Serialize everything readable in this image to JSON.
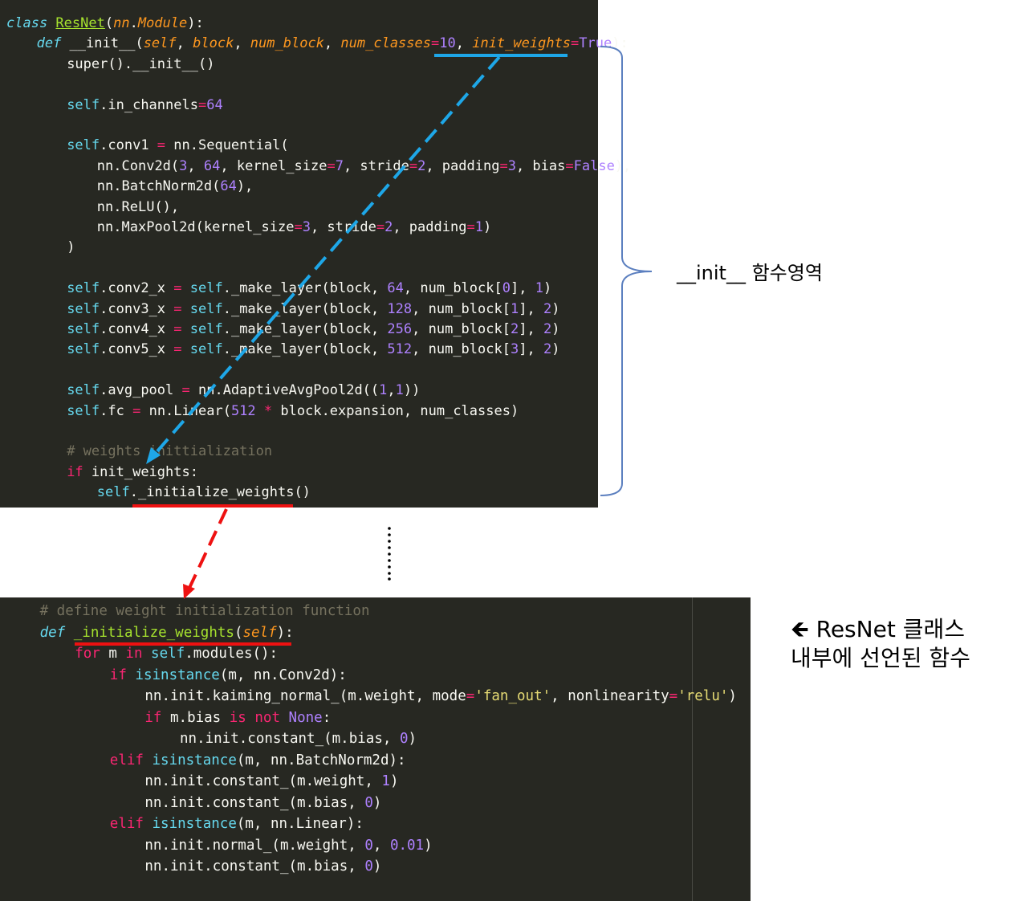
{
  "top_code": [
    {
      "indent": 0,
      "tokens": [
        [
          "class ",
          "kw-italic"
        ],
        [
          "ResNet",
          "class"
        ],
        [
          "(",
          "plain"
        ],
        [
          "nn",
          "param"
        ],
        [
          ".",
          "plain"
        ],
        [
          "Module",
          "param"
        ],
        [
          "):",
          "plain"
        ]
      ]
    },
    {
      "indent": 4,
      "tokens": [
        [
          "def ",
          "kw-italic"
        ],
        [
          "__init__",
          "plain"
        ],
        [
          "(",
          "plain"
        ],
        [
          "self",
          "param"
        ],
        [
          ", ",
          "plain"
        ],
        [
          "block",
          "param"
        ],
        [
          ", ",
          "plain"
        ],
        [
          "num_block",
          "param"
        ],
        [
          ", ",
          "plain"
        ],
        [
          "num_classes",
          "param"
        ],
        [
          "=",
          "op"
        ],
        [
          "10",
          "num"
        ],
        [
          ", ",
          "plain"
        ],
        [
          "init_weights",
          "param"
        ],
        [
          "=",
          "op"
        ],
        [
          "True",
          "const"
        ],
        [
          "):",
          "plain"
        ]
      ]
    },
    {
      "indent": 8,
      "tokens": [
        [
          "super",
          "plain"
        ],
        [
          "().",
          "plain"
        ],
        [
          "__init__",
          "plain"
        ],
        [
          "()",
          "plain"
        ]
      ]
    },
    {
      "indent": 0,
      "tokens": []
    },
    {
      "indent": 8,
      "tokens": [
        [
          "self",
          "self"
        ],
        [
          ".in_channels",
          "plain"
        ],
        [
          "=",
          "op"
        ],
        [
          "64",
          "num"
        ]
      ]
    },
    {
      "indent": 0,
      "tokens": []
    },
    {
      "indent": 8,
      "tokens": [
        [
          "self",
          "self"
        ],
        [
          ".conv1 ",
          "plain"
        ],
        [
          "=",
          "op"
        ],
        [
          " nn.Sequential(",
          "plain"
        ]
      ]
    },
    {
      "indent": 12,
      "tokens": [
        [
          "nn.Conv2d(",
          "plain"
        ],
        [
          "3",
          "num"
        ],
        [
          ", ",
          "plain"
        ],
        [
          "64",
          "num"
        ],
        [
          ", kernel_size",
          "plain"
        ],
        [
          "=",
          "op"
        ],
        [
          "7",
          "num"
        ],
        [
          ", stride",
          "plain"
        ],
        [
          "=",
          "op"
        ],
        [
          "2",
          "num"
        ],
        [
          ", padding",
          "plain"
        ],
        [
          "=",
          "op"
        ],
        [
          "3",
          "num"
        ],
        [
          ", bias",
          "plain"
        ],
        [
          "=",
          "op"
        ],
        [
          "False",
          "const"
        ],
        [
          "),",
          "plain"
        ]
      ]
    },
    {
      "indent": 12,
      "tokens": [
        [
          "nn.BatchNorm2d(",
          "plain"
        ],
        [
          "64",
          "num"
        ],
        [
          "),",
          "plain"
        ]
      ]
    },
    {
      "indent": 12,
      "tokens": [
        [
          "nn.ReLU(),",
          "plain"
        ]
      ]
    },
    {
      "indent": 12,
      "tokens": [
        [
          "nn.MaxPool2d(kernel_size",
          "plain"
        ],
        [
          "=",
          "op"
        ],
        [
          "3",
          "num"
        ],
        [
          ", stride",
          "plain"
        ],
        [
          "=",
          "op"
        ],
        [
          "2",
          "num"
        ],
        [
          ", padding",
          "plain"
        ],
        [
          "=",
          "op"
        ],
        [
          "1",
          "num"
        ],
        [
          ")",
          "plain"
        ]
      ]
    },
    {
      "indent": 8,
      "tokens": [
        [
          ")",
          "plain"
        ]
      ]
    },
    {
      "indent": 0,
      "tokens": []
    },
    {
      "indent": 8,
      "tokens": [
        [
          "self",
          "self"
        ],
        [
          ".conv2_x ",
          "plain"
        ],
        [
          "=",
          "op"
        ],
        [
          " ",
          "plain"
        ],
        [
          "self",
          "self"
        ],
        [
          "._make_layer(block, ",
          "plain"
        ],
        [
          "64",
          "num"
        ],
        [
          ", num_block[",
          "plain"
        ],
        [
          "0",
          "num"
        ],
        [
          "], ",
          "plain"
        ],
        [
          "1",
          "num"
        ],
        [
          ")",
          "plain"
        ]
      ]
    },
    {
      "indent": 8,
      "tokens": [
        [
          "self",
          "self"
        ],
        [
          ".conv3_x ",
          "plain"
        ],
        [
          "=",
          "op"
        ],
        [
          " ",
          "plain"
        ],
        [
          "self",
          "self"
        ],
        [
          "._make_layer(block, ",
          "plain"
        ],
        [
          "128",
          "num"
        ],
        [
          ", num_block[",
          "plain"
        ],
        [
          "1",
          "num"
        ],
        [
          "], ",
          "plain"
        ],
        [
          "2",
          "num"
        ],
        [
          ")",
          "plain"
        ]
      ]
    },
    {
      "indent": 8,
      "tokens": [
        [
          "self",
          "self"
        ],
        [
          ".conv4_x ",
          "plain"
        ],
        [
          "=",
          "op"
        ],
        [
          " ",
          "plain"
        ],
        [
          "self",
          "self"
        ],
        [
          "._make_layer(block, ",
          "plain"
        ],
        [
          "256",
          "num"
        ],
        [
          ", num_block[",
          "plain"
        ],
        [
          "2",
          "num"
        ],
        [
          "], ",
          "plain"
        ],
        [
          "2",
          "num"
        ],
        [
          ")",
          "plain"
        ]
      ]
    },
    {
      "indent": 8,
      "tokens": [
        [
          "self",
          "self"
        ],
        [
          ".conv5_x ",
          "plain"
        ],
        [
          "=",
          "op"
        ],
        [
          " ",
          "plain"
        ],
        [
          "self",
          "self"
        ],
        [
          "._make_layer(block, ",
          "plain"
        ],
        [
          "512",
          "num"
        ],
        [
          ", num_block[",
          "plain"
        ],
        [
          "3",
          "num"
        ],
        [
          "], ",
          "plain"
        ],
        [
          "2",
          "num"
        ],
        [
          ")",
          "plain"
        ]
      ]
    },
    {
      "indent": 0,
      "tokens": []
    },
    {
      "indent": 8,
      "tokens": [
        [
          "self",
          "self"
        ],
        [
          ".avg_pool ",
          "plain"
        ],
        [
          "=",
          "op"
        ],
        [
          " nn.AdaptiveAvgPool2d((",
          "plain"
        ],
        [
          "1",
          "num"
        ],
        [
          ",",
          "plain"
        ],
        [
          "1",
          "num"
        ],
        [
          "))",
          "plain"
        ]
      ]
    },
    {
      "indent": 8,
      "tokens": [
        [
          "self",
          "self"
        ],
        [
          ".fc ",
          "plain"
        ],
        [
          "=",
          "op"
        ],
        [
          " nn.Linear(",
          "plain"
        ],
        [
          "512",
          "num"
        ],
        [
          " ",
          "plain"
        ],
        [
          "*",
          "op"
        ],
        [
          " block.expansion, num_classes)",
          "plain"
        ]
      ]
    },
    {
      "indent": 0,
      "tokens": []
    },
    {
      "indent": 8,
      "tokens": [
        [
          "# weights inittialization",
          "cmt"
        ]
      ]
    },
    {
      "indent": 8,
      "tokens": [
        [
          "if",
          "kw"
        ],
        [
          " init_weights:",
          "plain"
        ]
      ]
    },
    {
      "indent": 12,
      "tokens": [
        [
          "self",
          "self"
        ],
        [
          "._initialize_weights()",
          "plain"
        ]
      ]
    }
  ],
  "bottom_code": [
    {
      "indent": 4,
      "tokens": [
        [
          "# define weight initialization function",
          "cmt"
        ]
      ]
    },
    {
      "indent": 4,
      "tokens": [
        [
          "def ",
          "kw-italic"
        ],
        [
          "_initialize_weights",
          "fn"
        ],
        [
          "(",
          "plain"
        ],
        [
          "self",
          "param"
        ],
        [
          "):",
          "plain"
        ]
      ]
    },
    {
      "indent": 8,
      "tokens": [
        [
          "for",
          "kw"
        ],
        [
          " m ",
          "plain"
        ],
        [
          "in",
          "kw"
        ],
        [
          " ",
          "plain"
        ],
        [
          "self",
          "self"
        ],
        [
          ".modules():",
          "plain"
        ]
      ]
    },
    {
      "indent": 12,
      "tokens": [
        [
          "if",
          "kw"
        ],
        [
          " ",
          "plain"
        ],
        [
          "isinstance",
          "builtin"
        ],
        [
          "(m, nn.Conv2d):",
          "plain"
        ]
      ]
    },
    {
      "indent": 16,
      "tokens": [
        [
          "nn.init.kaiming_normal_(m.weight, mode",
          "plain"
        ],
        [
          "=",
          "op"
        ],
        [
          "'fan_out'",
          "str"
        ],
        [
          ", nonlinearity",
          "plain"
        ],
        [
          "=",
          "op"
        ],
        [
          "'relu'",
          "str"
        ],
        [
          ")",
          "plain"
        ]
      ]
    },
    {
      "indent": 16,
      "tokens": [
        [
          "if",
          "kw"
        ],
        [
          " m.bias ",
          "plain"
        ],
        [
          "is",
          "kw"
        ],
        [
          " ",
          "plain"
        ],
        [
          "not",
          "kw"
        ],
        [
          " ",
          "plain"
        ],
        [
          "None",
          "const"
        ],
        [
          ":",
          "plain"
        ]
      ]
    },
    {
      "indent": 20,
      "tokens": [
        [
          "nn.init.constant_(m.bias, ",
          "plain"
        ],
        [
          "0",
          "num"
        ],
        [
          ")",
          "plain"
        ]
      ]
    },
    {
      "indent": 12,
      "tokens": [
        [
          "elif",
          "kw"
        ],
        [
          " ",
          "plain"
        ],
        [
          "isinstance",
          "builtin"
        ],
        [
          "(m, nn.BatchNorm2d):",
          "plain"
        ]
      ]
    },
    {
      "indent": 16,
      "tokens": [
        [
          "nn.init.constant_(m.weight, ",
          "plain"
        ],
        [
          "1",
          "num"
        ],
        [
          ")",
          "plain"
        ]
      ]
    },
    {
      "indent": 16,
      "tokens": [
        [
          "nn.init.constant_(m.bias, ",
          "plain"
        ],
        [
          "0",
          "num"
        ],
        [
          ")",
          "plain"
        ]
      ]
    },
    {
      "indent": 12,
      "tokens": [
        [
          "elif",
          "kw"
        ],
        [
          " ",
          "plain"
        ],
        [
          "isinstance",
          "builtin"
        ],
        [
          "(m, nn.Linear):",
          "plain"
        ]
      ]
    },
    {
      "indent": 16,
      "tokens": [
        [
          "nn.init.normal_(m.weight, ",
          "plain"
        ],
        [
          "0",
          "num"
        ],
        [
          ", ",
          "plain"
        ],
        [
          "0.01",
          "num"
        ],
        [
          ")",
          "plain"
        ]
      ]
    },
    {
      "indent": 16,
      "tokens": [
        [
          "nn.init.constant_(m.bias, ",
          "plain"
        ],
        [
          "0",
          "num"
        ],
        [
          ")",
          "plain"
        ]
      ]
    }
  ],
  "annotations": {
    "init_region_label": "__init__ 함수영역",
    "inner_function_label": "🡸 ResNet 클래스\n내부에 선언된 함수"
  },
  "colors": {
    "editor_bg": "#272822",
    "blue_arrow": "#1ea7e8",
    "red_arrow": "#ee1111",
    "brace": "#5b7fbf"
  }
}
